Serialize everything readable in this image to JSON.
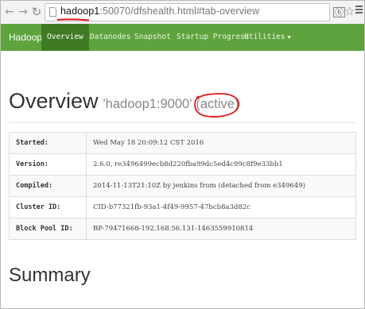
{
  "browser": {
    "url_host": "hadoop1",
    "url_rest": ":50070/dfshealth.html#tab-overview"
  },
  "navbar": {
    "brand": "Hadoop",
    "items": [
      {
        "label": "Overview"
      },
      {
        "label": "Datanodes"
      },
      {
        "label": "Snapshot"
      },
      {
        "label": "Startup Progress"
      },
      {
        "label": "Utilities"
      }
    ],
    "active_color": "#3f7a24",
    "bar_color": "#5fa33e"
  },
  "page": {
    "title": "Overview",
    "namenode": "'hadoop1:9000'",
    "state": "(active)"
  },
  "info_table": [
    {
      "key": "Started:",
      "value": "Wed May 18 20:09:12 CST 2016"
    },
    {
      "key": "Version:",
      "value": "2.6.0, re3496499ecb8d220fba99dc5ed4c99c8f9e33bb1"
    },
    {
      "key": "Compiled:",
      "value": "2014-11-13T21:10Z by jenkins from (detached from e349649)"
    },
    {
      "key": "Cluster ID:",
      "value": "CID-b77321fb-93a1-4f49-9957-47bcb8a3d82c"
    },
    {
      "key": "Block Pool ID:",
      "value": "BP-79471668-192.168.56.131-1463559910814"
    }
  ],
  "summary": {
    "title": "Summary"
  },
  "annotation_color": "#e0191c"
}
